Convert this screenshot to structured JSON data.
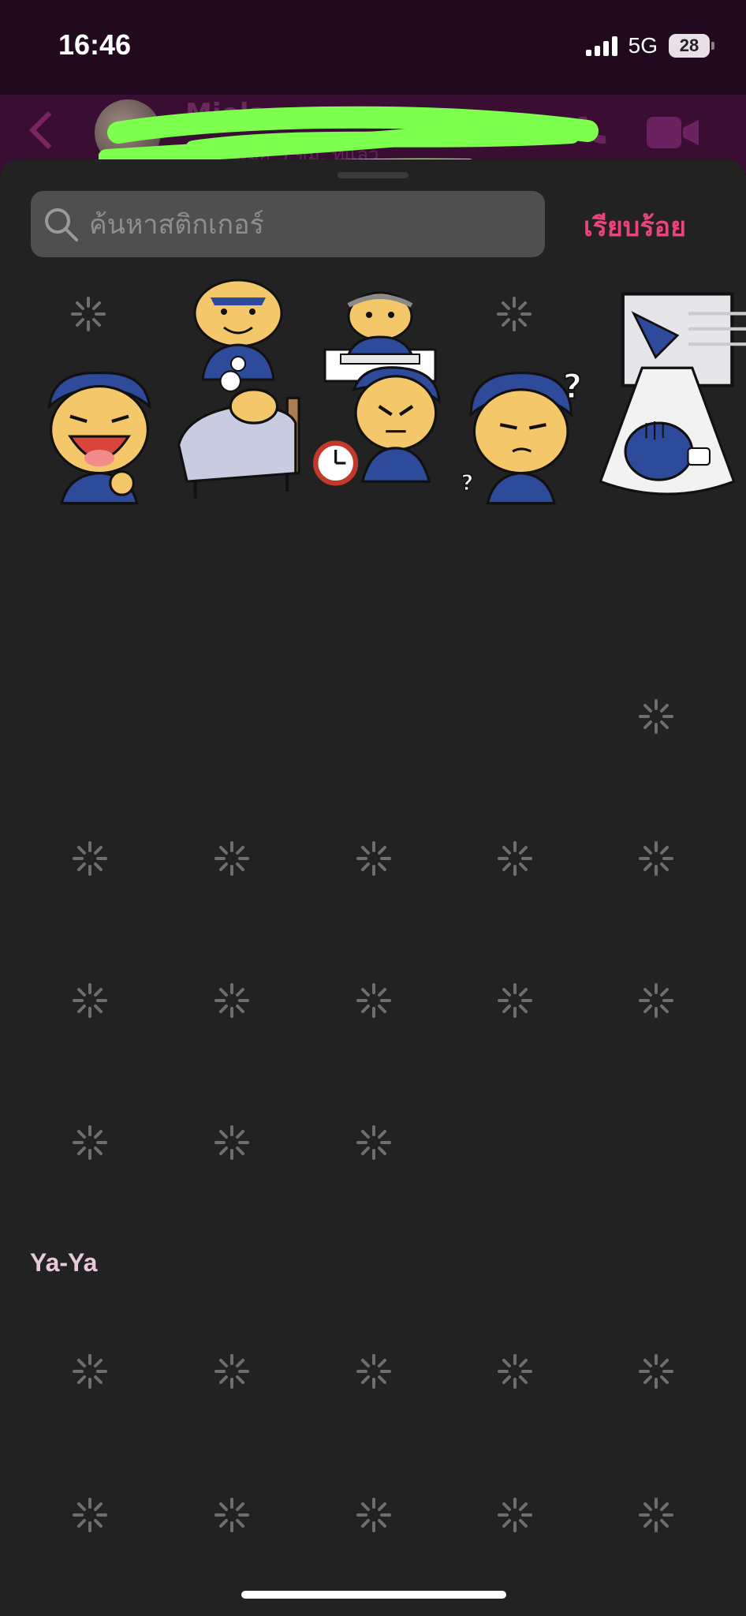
{
  "status_bar": {
    "time": "16:46",
    "network": "5G",
    "battery": "28"
  },
  "header": {
    "title": "Miola",
    "subtitle": "ใช้งานเมื่อ 3 ชม. ที่แล้ว"
  },
  "search": {
    "placeholder": "ค้นหาสติกเกอร์",
    "done_label": "เรียบร้อย"
  },
  "sections": [
    {
      "label": "Ya-Ya"
    }
  ],
  "colors": {
    "accent": "#e8457a",
    "sheet_background": "#222222",
    "header_background": "#3a0e33",
    "redaction": "#7dff4d"
  },
  "icons": {
    "back": "chevron-left-icon",
    "call": "phone-icon",
    "video": "video-camera-icon",
    "search": "search-icon",
    "loading": "spinner-icon"
  }
}
